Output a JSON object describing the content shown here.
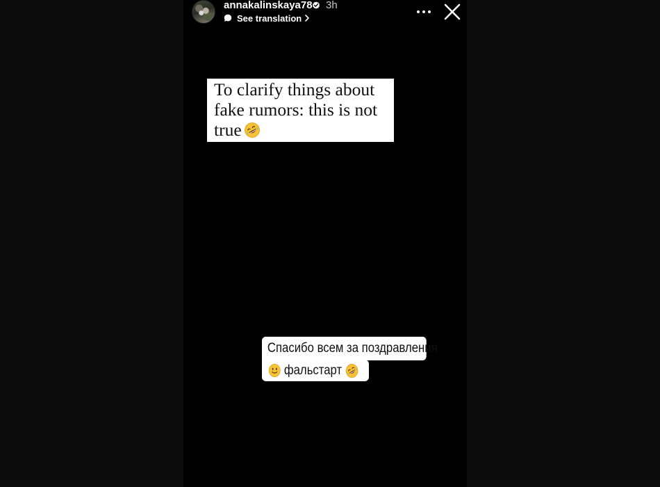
{
  "story": {
    "username": "annakalinskaya78",
    "verified_icon": "verified-badge-icon",
    "time": "3h",
    "see_translation_label": "See translation",
    "translation_icon": "speech-bubble-icon",
    "more_icon": "more-horizontal-icon",
    "close_icon": "close-icon"
  },
  "stickers": {
    "english": {
      "text": "To clarify things about fake rumors: this is not true",
      "emoji": "rolling-on-floor-laughing-emoji"
    },
    "russian": {
      "line1": "Спасибо всем за поздравления",
      "line2": "фальстарт",
      "emoji_before": "slightly-smiling-face-emoji",
      "emoji_after": "rolling-on-floor-laughing-emoji"
    }
  },
  "colors": {
    "background": "#0b0b0b",
    "story_background": "#000000",
    "sticker_background": "#ffffff",
    "text_dark": "#111111",
    "text_light": "#ffffff",
    "emoji_yellow": "#f7c236"
  }
}
